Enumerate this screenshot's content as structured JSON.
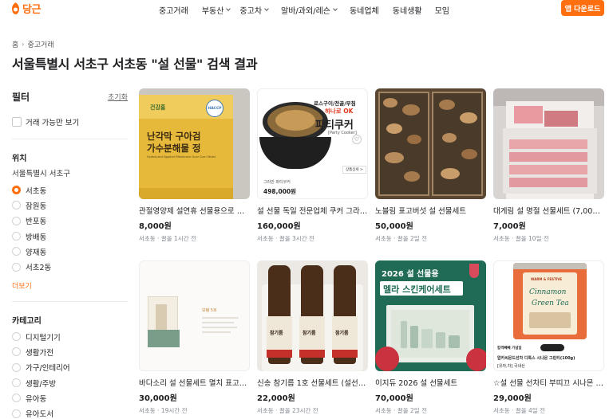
{
  "header": {
    "logo_text": "당근",
    "nav": [
      {
        "label": "중고거래",
        "dropdown": false
      },
      {
        "label": "부동산",
        "dropdown": true
      },
      {
        "label": "중고차",
        "dropdown": true
      },
      {
        "label": "알바/과외/레슨",
        "dropdown": true
      },
      {
        "label": "동네업체",
        "dropdown": false
      },
      {
        "label": "동네생활",
        "dropdown": false
      },
      {
        "label": "모임",
        "dropdown": false
      }
    ],
    "app_download": "앱 다운로드",
    "brand_color": "#ff6f0f"
  },
  "breadcrumb": {
    "home": "홈",
    "current": "중고거래"
  },
  "page_title": "서울특별시 서초구 서초동 \"설 선물\" 검색 결과",
  "sidebar": {
    "filter_title": "필터",
    "reset": "초기화",
    "available_only": "거래 가능만 보기",
    "location_title": "위치",
    "location_region": "서울특별시 서초구",
    "locations": [
      "서초동",
      "잠원동",
      "반포동",
      "방배동",
      "양재동",
      "서초2동"
    ],
    "selected_location": "서초동",
    "more": "더보기",
    "category_title": "카테고리",
    "categories": [
      "디지털기기",
      "생활가전",
      "가구/인테리어",
      "생활/주방",
      "유아동",
      "유아도서"
    ]
  },
  "listings": [
    {
      "title": "관절영양제 설연휴 선물용으로 드…",
      "price": "8,000원",
      "meta": "서초동 · 끌올 1시간 전",
      "thumb": {
        "line1": "난각막 구아검",
        "line2": "가수분해물 정",
        "brand": "건강홈",
        "badge": "HACCP",
        "sub": "Hydrolyzed Eggshell Membrane Guar Gum Tablet"
      }
    },
    {
      "title": "설 선물 독일 전문업체 쿠커 그라만…",
      "price": "160,000원",
      "meta": "서초동 · 끌올 3시간 전",
      "thumb": {
        "top": "로스구이/전골/부침",
        "mid": "하나로 OK",
        "big": "파티쿠커",
        "en": "[Party Cooker]",
        "brand": "그라만 파티쿠커",
        "price": "498,000원",
        "detail": "상품상세 >"
      }
    },
    {
      "title": "노블림 표고버섯 설 선물세트",
      "price": "50,000원",
      "meta": "서초동 · 끌올 2일 전",
      "thumb": {}
    },
    {
      "title": "대게림 설 명절 선물세트 (7,000원)",
      "price": "7,000원",
      "meta": "서초동 · 끌올 10일 전",
      "thumb": {}
    },
    {
      "title": "바다소리 설 선물세트 멸치 표고버섯",
      "price": "30,000원",
      "meta": "서초동 · 19시간 전",
      "thumb": {
        "label": "보탬 5호"
      }
    },
    {
      "title": "신송 참기름 1호 선물세트 (설선물…",
      "price": "22,000원",
      "meta": "서초동 · 끌올 23시간 전",
      "thumb": {
        "label": "참기름"
      }
    },
    {
      "title": "이지듀 2026 설 선물세트",
      "price": "70,000원",
      "meta": "서초동 · 끌올 2일 전",
      "thumb": {
        "year_line": "2026 설 선물용",
        "headline": "멜라 스킨케어세트"
      }
    },
    {
      "title": "☆설 선물 선차티 부띠끄 시나몬 그린…",
      "price": "29,000원",
      "meta": "서초동 · 끌올 4일 전",
      "thumb": {
        "can_top": "WARM & FESTIVE",
        "can_name1": "Cinnamon",
        "can_name2": "Green Tea",
        "caption1": "합격빼빼 기념일",
        "caption2": "압카씨몬드선차 디톡스 시나몬 그린티(100g)",
        "caption3": "[유자,차] 국내산"
      }
    }
  ]
}
